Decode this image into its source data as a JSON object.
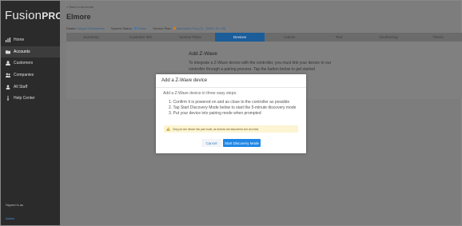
{
  "sidebar": {
    "logo_main": "Fusion",
    "logo_accent": "PRO",
    "items": [
      {
        "label": "Home",
        "icon": "bar-chart-icon"
      },
      {
        "label": "Accounts",
        "icon": "folder-icon"
      },
      {
        "label": "Customers",
        "icon": "person-icon"
      },
      {
        "label": "Companies",
        "icon": "companies-icon"
      },
      {
        "label": "All Staff",
        "icon": "staff-icon"
      },
      {
        "label": "Help Center",
        "icon": "info-icon"
      }
    ],
    "signed_in_label": "Signed in as",
    "signed_in_user": "Admin"
  },
  "header": {
    "breadcrumb": "« Back to Accounts",
    "title": "Elmore",
    "dealer_label": "Dealer:",
    "dealer_value": "Wayne Enterprises",
    "status_label": "System Status:",
    "status_value": "Online",
    "plan_label": "Service Plan:",
    "plan_value": "Interactive Plus (3) - [0000, 00, 00]"
  },
  "tabs": [
    "Summary",
    "Customer Info",
    "Service Plans",
    "Devices",
    "Actions",
    "Text",
    "Geofencing",
    "Timers"
  ],
  "content": {
    "title": "Add Z-Wave",
    "description": "To integrate a Z-Wave device with the controller, you must link your device to our controller through a pairing process. Tap the button below to get started"
  },
  "modal": {
    "title": "Add a Z-Wave device",
    "intro": "Add a Z-Wave device in three easy steps:",
    "steps": [
      "1. Confirm it is powered on and as close to the controller as possible",
      "2. Tap Start Discovery Mode below to start the 5-minute discovery mode",
      "3. Put your device into pairing mode when prompted"
    ],
    "warning": "Only put one device into pair mode, as devices are discovered one at a time.",
    "cancel_label": "Cancel",
    "start_label": "Start Discovery Mode"
  },
  "colors": {
    "sidebar_bg": "#2b2b2b",
    "active_tab": "#1b5d99",
    "primary_button": "#1f87e6",
    "warning_bg": "#fcf4d2",
    "status_online": "#2f7bd0",
    "status_plan": "#e07b1a"
  }
}
